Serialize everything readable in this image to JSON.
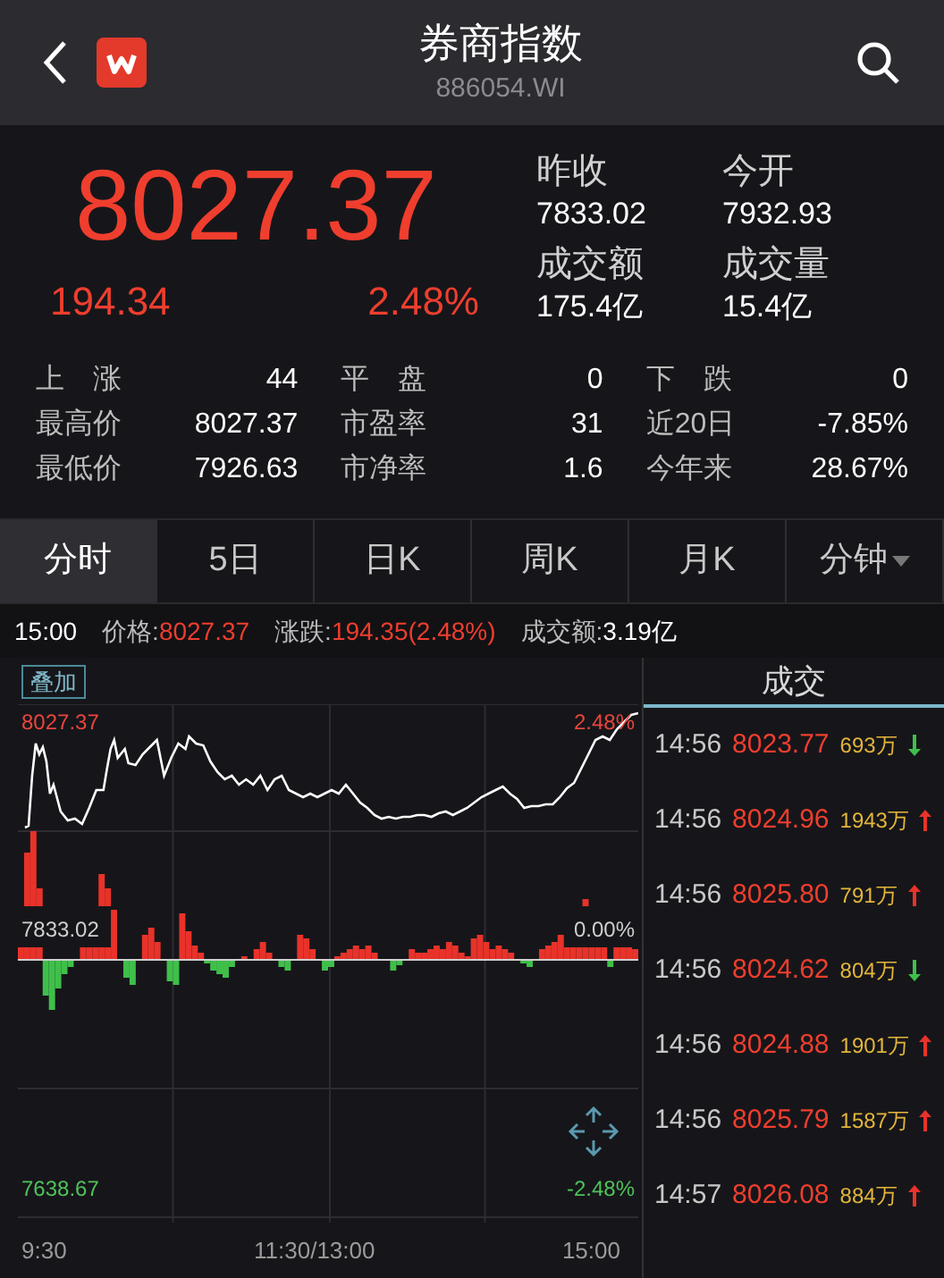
{
  "header": {
    "title": "券商指数",
    "code": "886054.WI"
  },
  "quote": {
    "price": "8027.37",
    "change": "194.34",
    "change_pct": "2.48%"
  },
  "summary": [
    {
      "label": "昨收",
      "value": "7833.02"
    },
    {
      "label": "今开",
      "value": "7932.93"
    },
    {
      "label": "成交额",
      "value": "175.4亿"
    },
    {
      "label": "成交量",
      "value": "15.4亿"
    }
  ],
  "stats": [
    {
      "label": "上　涨",
      "value": "44"
    },
    {
      "label": "平　盘",
      "value": "0"
    },
    {
      "label": "下　跌",
      "value": "0"
    },
    {
      "label": "最高价",
      "value": "8027.37"
    },
    {
      "label": "市盈率",
      "value": "31"
    },
    {
      "label": "近20日",
      "value": "-7.85%"
    },
    {
      "label": "最低价",
      "value": "7926.63"
    },
    {
      "label": "市净率",
      "value": "1.6"
    },
    {
      "label": "今年来",
      "value": "28.67%"
    }
  ],
  "tabs": [
    {
      "label": "分时",
      "selected": true
    },
    {
      "label": "5日",
      "selected": false
    },
    {
      "label": "日K",
      "selected": false
    },
    {
      "label": "周K",
      "selected": false
    },
    {
      "label": "月K",
      "selected": false
    },
    {
      "label": "分钟",
      "selected": false,
      "kind": "dropdown"
    }
  ],
  "info_bar": {
    "time": "15:00",
    "price_label": "价格:",
    "price": "8027.37",
    "change_label": "涨跌:",
    "change": "194.35(2.48%)",
    "amount_label": "成交额:",
    "amount": "3.19亿"
  },
  "chart": {
    "overlay_button": "叠加",
    "high": "8027.37",
    "high_pct": "2.48%",
    "base": "7833.02",
    "base_pct": "0.00%",
    "low": "7638.67",
    "low_pct": "-2.48%",
    "x_labels": [
      "9:30",
      "11:30/13:00",
      "15:00"
    ]
  },
  "trades": {
    "title": "成交",
    "rows": [
      {
        "time": "14:56",
        "price": "8023.77",
        "volume": "693万",
        "rising": false
      },
      {
        "time": "14:56",
        "price": "8024.96",
        "volume": "1943万",
        "rising": true
      },
      {
        "time": "14:56",
        "price": "8025.80",
        "volume": "791万",
        "rising": true
      },
      {
        "time": "14:56",
        "price": "8024.62",
        "volume": "804万",
        "rising": false
      },
      {
        "time": "14:56",
        "price": "8024.88",
        "volume": "1901万",
        "rising": true
      },
      {
        "time": "14:56",
        "price": "8025.79",
        "volume": "1587万",
        "rising": true
      },
      {
        "time": "14:57",
        "price": "8026.08",
        "volume": "884万",
        "rising": true
      }
    ]
  }
}
